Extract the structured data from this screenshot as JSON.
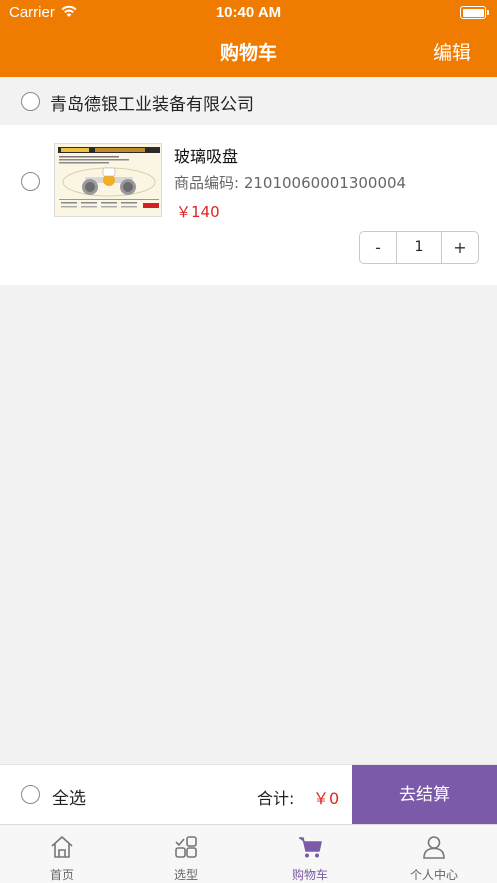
{
  "status_bar": {
    "carrier": "Carrier",
    "time": "10:40 AM"
  },
  "nav": {
    "title": "购物车",
    "edit_label": "编辑"
  },
  "shop": {
    "name": "青岛德银工业装备有限公司"
  },
  "cart_item": {
    "name": "玻璃吸盘",
    "code_label": "商品编码:",
    "code": "21010060001300004",
    "price": "￥140",
    "decrement": "-",
    "quantity": "1",
    "increment": "+"
  },
  "checkout": {
    "select_all": "全选",
    "total_label": "合计:",
    "total_amount": "￥0",
    "pay_label": "去结算"
  },
  "tabs": [
    {
      "label": "首页",
      "icon": "home-icon",
      "active": false
    },
    {
      "label": "选型",
      "icon": "selection-icon",
      "active": false
    },
    {
      "label": "购物车",
      "icon": "cart-icon",
      "active": true
    },
    {
      "label": "个人中心",
      "icon": "user-icon",
      "active": false
    }
  ],
  "colors": {
    "brand_orange": "#ef7b00",
    "accent_purple": "#7b5aa9",
    "price_red": "#e02424"
  }
}
